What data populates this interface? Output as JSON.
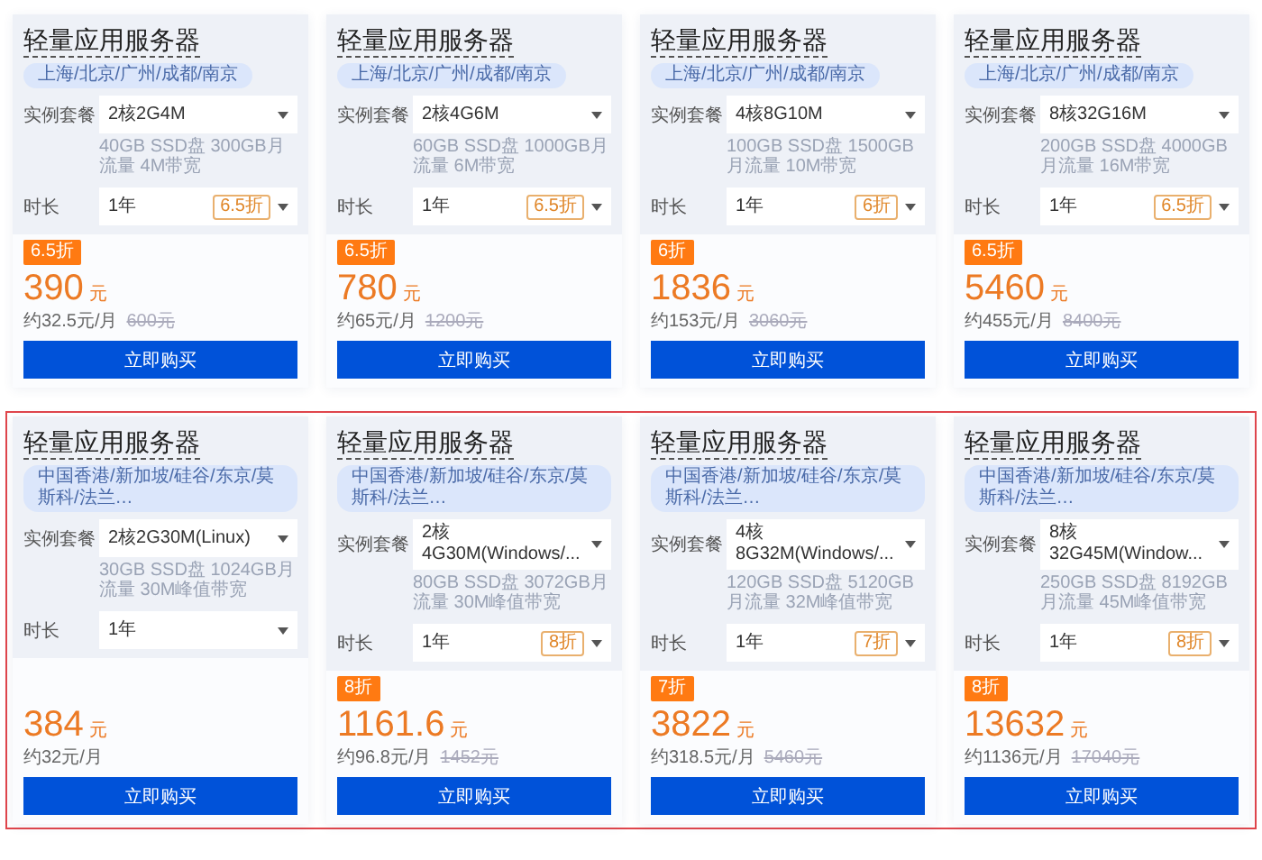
{
  "rows": [
    {
      "highlighted": false,
      "cards": [
        {
          "title": "轻量应用服务器",
          "regions": "上海/北京/广州/成都/南京",
          "plan_label": "实例套餐",
          "plan": "2核2G4M",
          "spec": "40GB SSD盘 300GB月流量 4M带宽",
          "duration_label": "时长",
          "duration": "1年",
          "duration_discount": "6.5折",
          "discount": "6.5折",
          "price": "390",
          "unit": "元",
          "monthly": "约32.5元/月",
          "original_price": "600元",
          "button": "立即购买"
        },
        {
          "title": "轻量应用服务器",
          "regions": "上海/北京/广州/成都/南京",
          "plan_label": "实例套餐",
          "plan": "2核4G6M",
          "spec": "60GB SSD盘 1000GB月流量 6M带宽",
          "duration_label": "时长",
          "duration": "1年",
          "duration_discount": "6.5折",
          "discount": "6.5折",
          "price": "780",
          "unit": "元",
          "monthly": "约65元/月",
          "original_price": "1200元",
          "button": "立即购买"
        },
        {
          "title": "轻量应用服务器",
          "regions": "上海/北京/广州/成都/南京",
          "plan_label": "实例套餐",
          "plan": "4核8G10M",
          "spec": "100GB SSD盘 1500GB月流量 10M带宽",
          "duration_label": "时长",
          "duration": "1年",
          "duration_discount": "6折",
          "discount": "6折",
          "price": "1836",
          "unit": "元",
          "monthly": "约153元/月",
          "original_price": "3060元",
          "button": "立即购买"
        },
        {
          "title": "轻量应用服务器",
          "regions": "上海/北京/广州/成都/南京",
          "plan_label": "实例套餐",
          "plan": "8核32G16M",
          "spec": "200GB SSD盘 4000GB月流量 16M带宽",
          "duration_label": "时长",
          "duration": "1年",
          "duration_discount": "6.5折",
          "discount": "6.5折",
          "price": "5460",
          "unit": "元",
          "monthly": "约455元/月",
          "original_price": "8400元",
          "button": "立即购买"
        }
      ]
    },
    {
      "highlighted": true,
      "cards": [
        {
          "title": "轻量应用服务器",
          "regions": "中国香港/新加坡/硅谷/东京/莫斯科/法兰…",
          "plan_label": "实例套餐",
          "plan": "2核2G30M(Linux)",
          "spec": "30GB SSD盘 1024GB月流量 30M峰值带宽",
          "duration_label": "时长",
          "duration": "1年",
          "price": "384",
          "unit": "元",
          "monthly": "约32元/月",
          "button": "立即购买"
        },
        {
          "title": "轻量应用服务器",
          "regions": "中国香港/新加坡/硅谷/东京/莫斯科/法兰…",
          "plan_label": "实例套餐",
          "plan": "2核4G30M(Windows/...",
          "spec": "80GB SSD盘 3072GB月流量 30M峰值带宽",
          "duration_label": "时长",
          "duration": "1年",
          "duration_discount": "8折",
          "discount": "8折",
          "price": "1161.6",
          "unit": "元",
          "monthly": "约96.8元/月",
          "original_price": "1452元",
          "button": "立即购买"
        },
        {
          "title": "轻量应用服务器",
          "regions": "中国香港/新加坡/硅谷/东京/莫斯科/法兰…",
          "plan_label": "实例套餐",
          "plan": "4核8G32M(Windows/...",
          "spec": "120GB SSD盘 5120GB月流量 32M峰值带宽",
          "duration_label": "时长",
          "duration": "1年",
          "duration_discount": "7折",
          "discount": "7折",
          "price": "3822",
          "unit": "元",
          "monthly": "约318.5元/月",
          "original_price": "5460元",
          "button": "立即购买"
        },
        {
          "title": "轻量应用服务器",
          "regions": "中国香港/新加坡/硅谷/东京/莫斯科/法兰…",
          "plan_label": "实例套餐",
          "plan": "8核32G45M(Window...",
          "spec": "250GB SSD盘 8192GB月流量 45M峰值带宽",
          "duration_label": "时长",
          "duration": "1年",
          "duration_discount": "8折",
          "discount": "8折",
          "price": "13632",
          "unit": "元",
          "monthly": "约1136元/月",
          "original_price": "17040元",
          "button": "立即购买"
        }
      ]
    }
  ]
}
